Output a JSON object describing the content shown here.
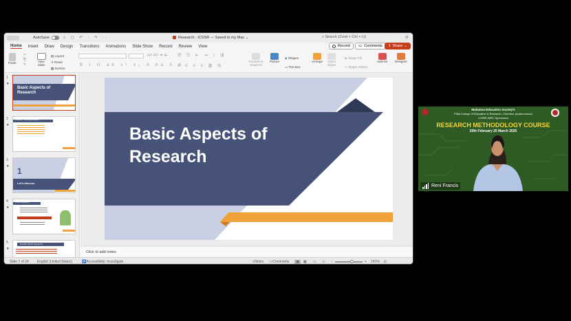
{
  "titlebar": {
    "autosave_label": "AutoSave",
    "qa_icons": "⌂ ▢ ↶ · ↷ ···",
    "doc_title": "Research - ICSSR — Saved to my Mac ⌄",
    "search_placeholder": "Search (Cmd + Ctrl + U)"
  },
  "tabs": [
    "Home",
    "Insert",
    "Draw",
    "Design",
    "Transitions",
    "Animations",
    "Slide Show",
    "Record",
    "Review",
    "View"
  ],
  "active_tab": "Home",
  "actions": {
    "record": "Record",
    "comments": "Comments",
    "share": "Share"
  },
  "ribbon": {
    "paste": "Paste",
    "new_slide": "New\nSlide",
    "layout": "Layout",
    "reset": "Reset",
    "section": "Section",
    "convert": "Convert to\nSmartArt",
    "picture": "Picture",
    "shapes": "Shapes",
    "text_box": "Text Box",
    "arrange": "Arrange",
    "quick_styles": "Quick\nStyles",
    "shape_fill": "Shape Fill",
    "shape_outline": "Shape Outline",
    "addins": "Add-ins",
    "designer": "Designer"
  },
  "thumbnails": [
    {
      "num": "1",
      "title": "Basic Aspects of Research",
      "selected": true
    },
    {
      "num": "2",
      "title": "Overview – Learning outcomes",
      "selected": false
    },
    {
      "num": "3",
      "title": "1",
      "subtitle": "Let's discuss",
      "selected": false
    },
    {
      "num": "4",
      "title": "What is Research?",
      "selected": false
    },
    {
      "num": "5",
      "title": "Scientific Method Research is",
      "selected": false
    }
  ],
  "slide": {
    "title_line1": "Basic Aspects of",
    "title_line2": "Research"
  },
  "notes_placeholder": "Click to add notes",
  "status": {
    "slide_of": "Slide 1 of 24",
    "language": "English (United States)",
    "accessibility": "Accessibility: Investigate",
    "notes": "Notes",
    "comments": "Comments",
    "zoom": "141%"
  },
  "video": {
    "line1": "Mahatma Education Society's",
    "line2": "Pillai College of Education & Research, Chembur (Autonomous)",
    "line3": "ICSSR-WRC Sponsored",
    "course": "RESEARCH METHODOLOGY COURSE",
    "dates": "20th February 20    March 2025",
    "participant": "Reni Francis"
  },
  "colors": {
    "navy": "#465278",
    "light_blue": "#c9d0e3",
    "orange": "#f0a13a",
    "dark_navy": "#2e3857",
    "accent_red": "#c43e1c",
    "course_yellow": "#f5d33b"
  }
}
